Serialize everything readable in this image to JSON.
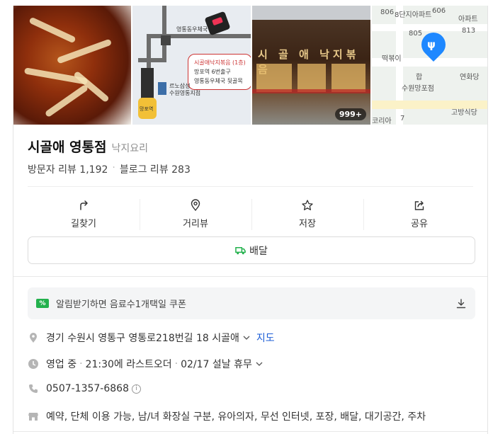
{
  "photos": {
    "count_badge": "999+",
    "sketch_map": {
      "post_office": "영통동우체국",
      "box_line1": "시골애낙지볶음 (1층)",
      "box_line2": "망포역 6번출구",
      "box_line3": "영통동우체국 뒷골목",
      "station": "망포역",
      "bank1": "르노삼성",
      "bank2": "수원영통지점"
    },
    "storefront_sign": "시 골 애   낙지볶음",
    "map": {
      "labels": [
        "806",
        "8단지아파트",
        "606",
        "아파트",
        "805",
        "813",
        "떡볶이",
        "합",
        "연화당",
        "수원망포점",
        "고방식당",
        "코리아",
        "7"
      ]
    }
  },
  "place": {
    "name": "시골애 영통점",
    "category": "낙지요리",
    "visitor_reviews": "방문자 리뷰 1,192",
    "blog_reviews": "블로그 리뷰 283"
  },
  "actions": [
    {
      "label": "길찾기",
      "icon": "directions-icon"
    },
    {
      "label": "거리뷰",
      "icon": "street-view-icon"
    },
    {
      "label": "저장",
      "icon": "star-icon"
    },
    {
      "label": "공유",
      "icon": "share-icon"
    }
  ],
  "delivery_button": "배달",
  "coupon": {
    "icon_text": "%",
    "text": "알림받기하면 음료수1개택일 쿠폰"
  },
  "info": {
    "address": "경기 수원시 영통구 영통로218번길 18 시골애",
    "map_link": "지도",
    "status": "영업 중",
    "last_order": "21:30에 라스트오더",
    "holiday": "02/17 설날 휴무",
    "phone": "0507-1357-6868",
    "info_mark": "i",
    "amenities": "예약, 단체 이용 가능, 남/녀 화장실 구분, 유아의자, 무선 인터넷, 포장, 배달, 대기공간, 주차"
  },
  "colors": {
    "accent_green": "#23b14d",
    "link_blue": "#1b5cd6",
    "map_pin": "#1e88ff"
  }
}
